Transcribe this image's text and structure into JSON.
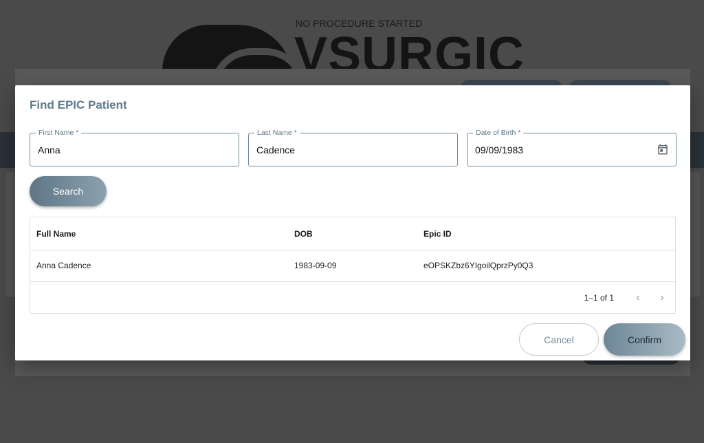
{
  "background": {
    "status_text": "NO PROCEDURE STARTED",
    "logo_text": "VSURGIC"
  },
  "dialog": {
    "title": "Find EPIC Patient",
    "fields": {
      "first_name": {
        "label": "First Name *",
        "value": "Anna"
      },
      "last_name": {
        "label": "Last Name *",
        "value": "Cadence"
      },
      "dob": {
        "label": "Date of Birth *",
        "value": "09/09/1983"
      }
    },
    "search_label": "Search",
    "table": {
      "headers": {
        "full_name": "Full Name",
        "dob": "DOB",
        "epic_id": "Epic ID"
      },
      "rows": [
        {
          "full_name": "Anna Cadence",
          "dob": "1983-09-09",
          "epic_id": "eOPSKZbz6YIgoilQprzPy0Q3"
        }
      ],
      "pagination": "1–1 of 1"
    },
    "cancel_label": "Cancel",
    "confirm_label": "Confirm"
  },
  "icons": {
    "calendar": "calendar-icon",
    "prev": "chevron-left-icon",
    "next": "chevron-right-icon"
  },
  "colors": {
    "accent": "#5e7686",
    "title": "#5d7a8c",
    "overlay": "#4a4a4a"
  }
}
